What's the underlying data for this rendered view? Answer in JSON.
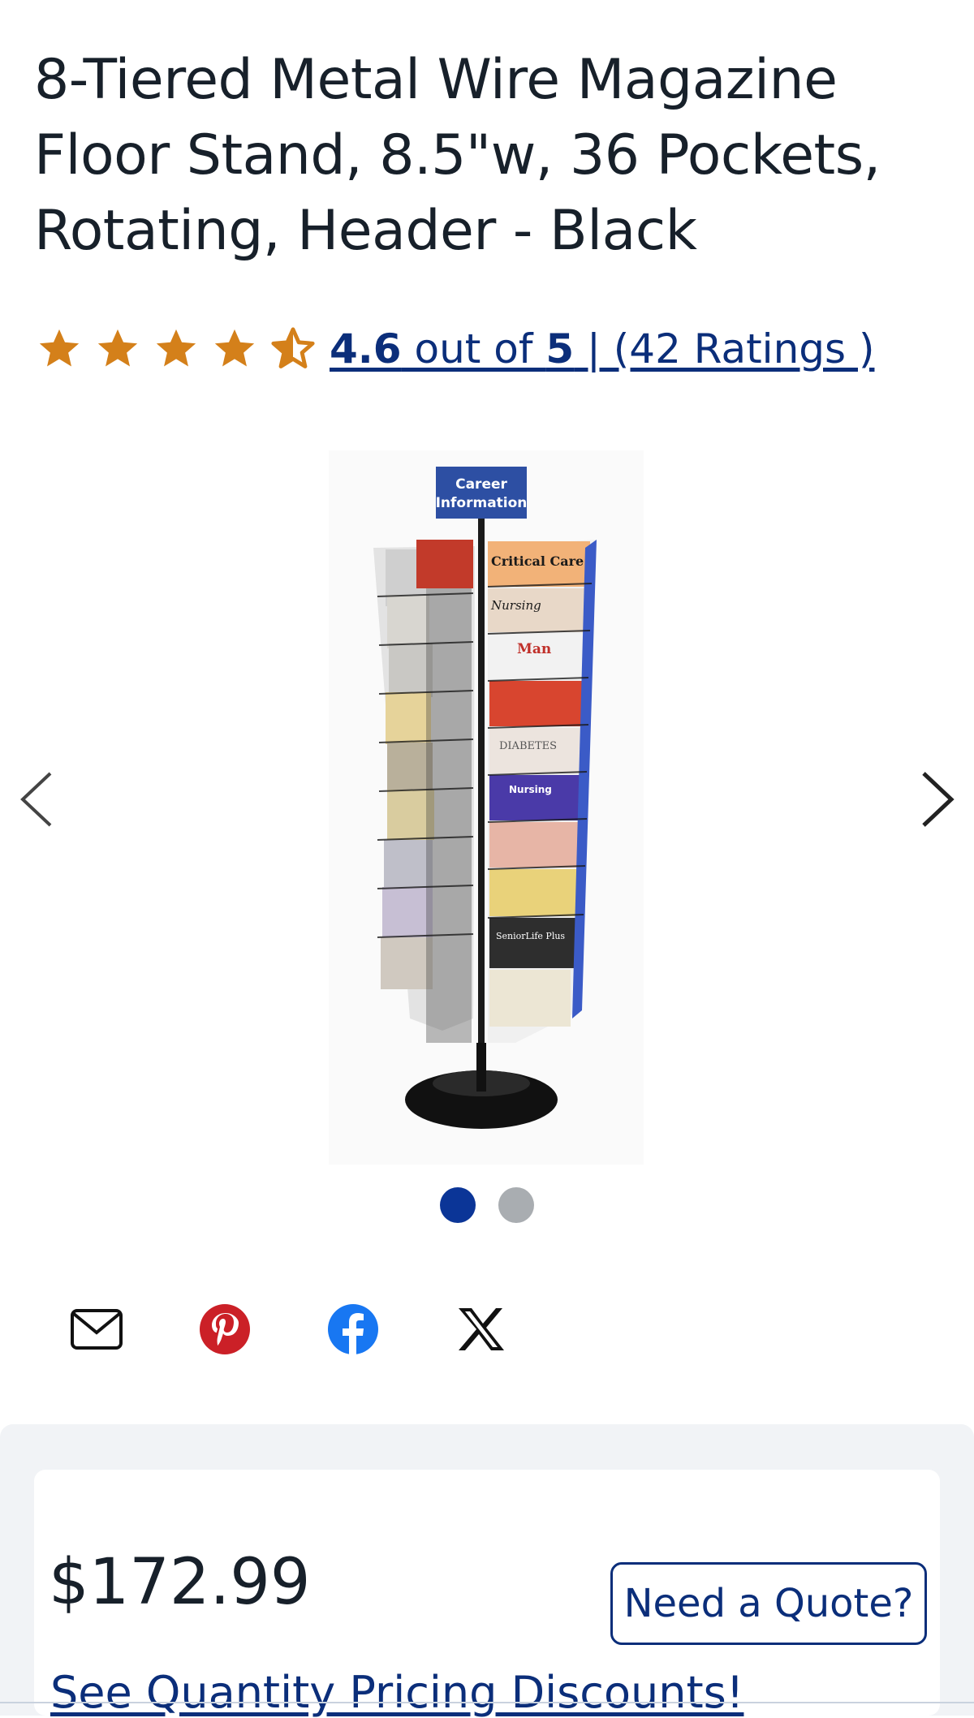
{
  "product": {
    "title": "8-Tiered Metal Wire Magazine Floor Stand, 8.5\"w, 36 Pockets, Rotating, Header - Black"
  },
  "rating": {
    "score": "4.6",
    "text_mid": " out of ",
    "max": "5",
    "text_tail": " | (42 Ratings )",
    "stars_value": 4.6,
    "star_color": "#d4801a"
  },
  "gallery": {
    "header_sign_line1": "Career",
    "header_sign_line2": "Information",
    "magazine_titles": [
      "Critical Care",
      "Nursing",
      "Man",
      "DIABETES",
      "Nursing",
      "SeniorLife Plus"
    ],
    "slide_count": 2,
    "active_slide": 1,
    "dot_active_color": "#0b3597",
    "dot_inactive_color": "#a9adb1"
  },
  "share": {
    "icons": [
      "email-icon",
      "pinterest-icon",
      "facebook-icon",
      "x-icon"
    ]
  },
  "pricing": {
    "price": "$172.99",
    "quote_label": "Need a Quote?",
    "quantity_link": "See Quantity Pricing Discounts!"
  },
  "colors": {
    "link": "#0b2e7a",
    "panel_bg": "#f1f3f6",
    "pinterest": "#cb2027",
    "facebook": "#1877f2"
  }
}
